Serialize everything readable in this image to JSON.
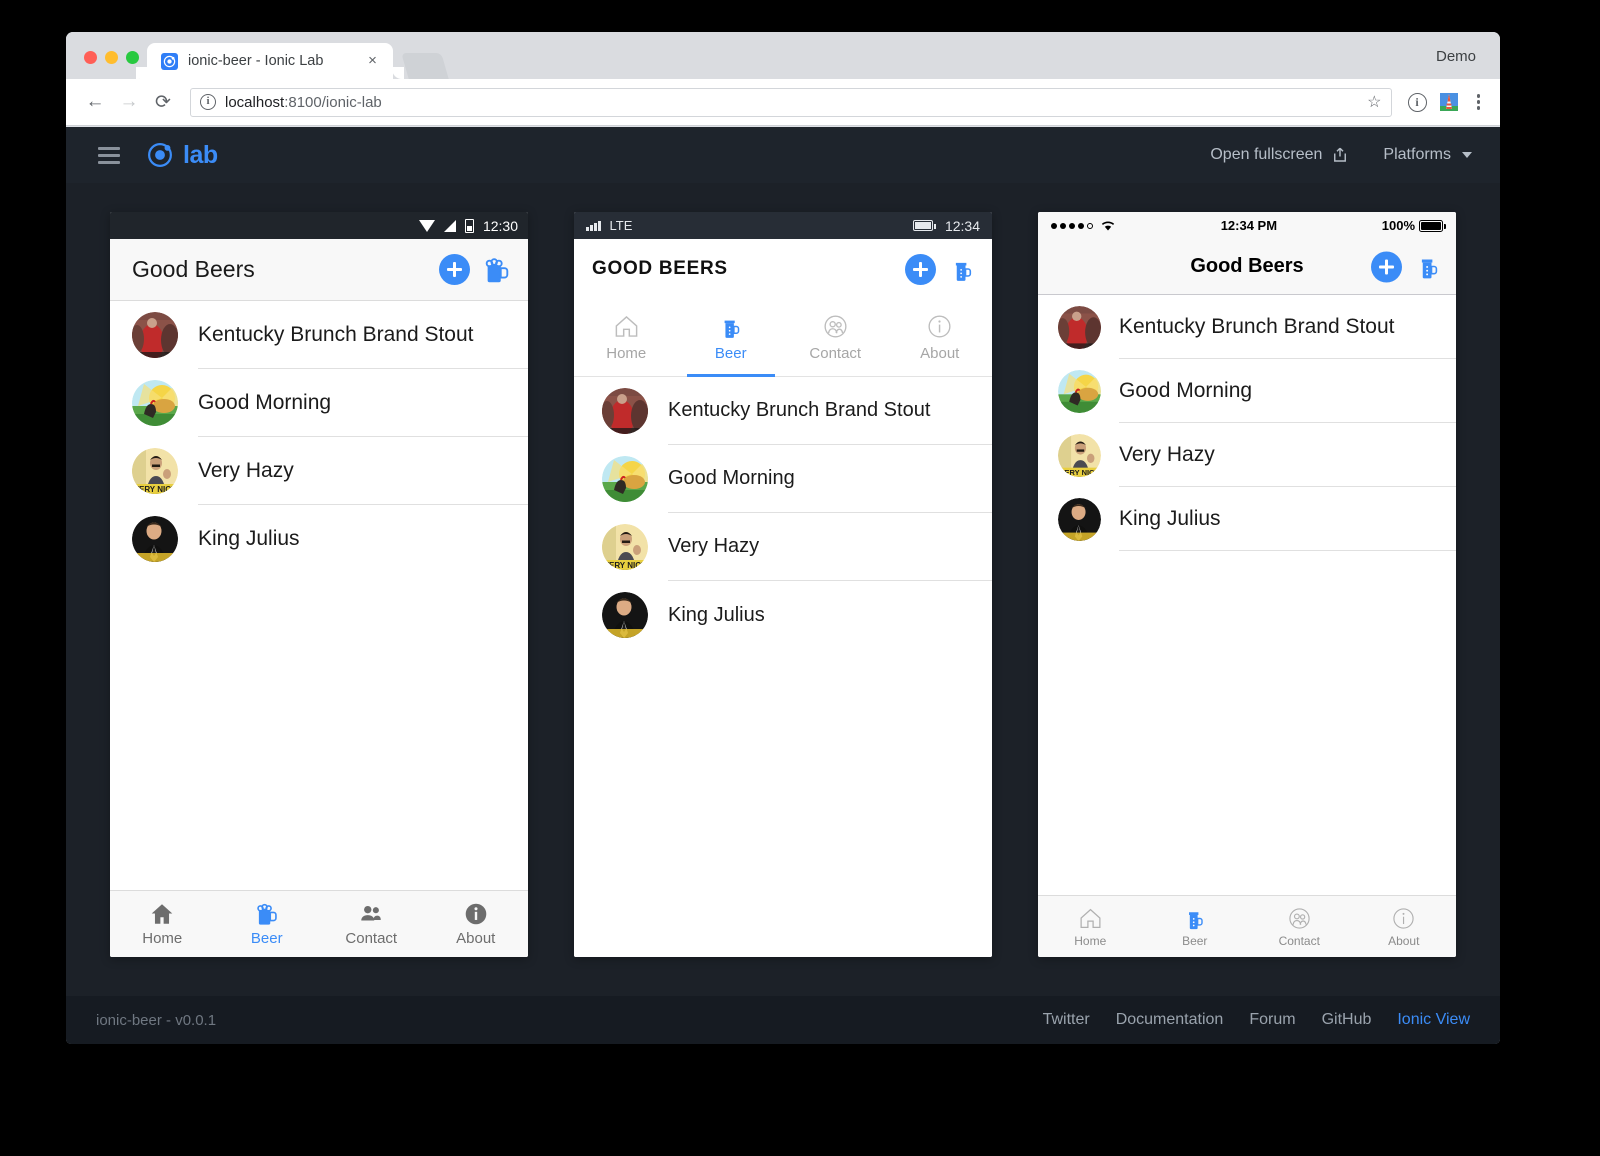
{
  "browser": {
    "tab": {
      "title": "ionic-beer - Ionic Lab",
      "favicon": "ionic-logo-icon",
      "close": "×"
    },
    "profile_label": "Demo",
    "url_prefix": "localhost",
    "url_suffix": ":8100/ionic-lab",
    "url_full": "localhost:8100/ionic-lab",
    "icons": {
      "back": "←",
      "forward": "→",
      "reload": "⟳",
      "site_info": "i",
      "bookmark": "☆",
      "page_info": "info-circle-icon",
      "extension": "lighthouse-icon",
      "menu": "kebab-menu-icon"
    }
  },
  "lab": {
    "brand": "lab",
    "fullscreen_label": "Open fullscreen",
    "platforms_label": "Platforms",
    "footer": {
      "version": "ionic-beer - v0.0.1",
      "links": [
        {
          "label": "Twitter",
          "accent": false
        },
        {
          "label": "Documentation",
          "accent": false
        },
        {
          "label": "Forum",
          "accent": false
        },
        {
          "label": "GitHub",
          "accent": false
        },
        {
          "label": "Ionic View",
          "accent": true
        }
      ]
    }
  },
  "beers": [
    {
      "name": "Kentucky Brunch Brand Stout",
      "avatar": "avatar-red-crowd"
    },
    {
      "name": "Good Morning",
      "avatar": "avatar-rooster-sunrise"
    },
    {
      "name": "Very Hazy",
      "avatar": "avatar-very-nice"
    },
    {
      "name": "King Julius",
      "avatar": "avatar-man-suit"
    }
  ],
  "devices": [
    {
      "platform": "android",
      "statusbar": {
        "time": "12:30",
        "icons": [
          "wifi-icon",
          "signal-icon",
          "battery-icon"
        ]
      },
      "title": "Good Beers",
      "actions": [
        {
          "name": "add-button",
          "icon": "plus-icon"
        },
        {
          "name": "beer-button",
          "icon": "beer-mug-icon"
        }
      ],
      "tabs_position": "bottom",
      "tabs": [
        {
          "label": "Home",
          "icon": "home-icon",
          "active": false
        },
        {
          "label": "Beer",
          "icon": "beer-mug-icon",
          "active": true
        },
        {
          "label": "Contact",
          "icon": "contacts-icon",
          "active": false
        },
        {
          "label": "About",
          "icon": "info-icon",
          "active": false
        }
      ]
    },
    {
      "platform": "windows",
      "statusbar": {
        "network": "LTE",
        "time": "12:34",
        "icons": [
          "signal-bars-icon",
          "battery-icon"
        ]
      },
      "title": "GOOD BEERS",
      "actions": [
        {
          "name": "add-button",
          "icon": "plus-icon"
        },
        {
          "name": "beer-button",
          "icon": "beer-mug-icon"
        }
      ],
      "tabs_position": "top",
      "tabs": [
        {
          "label": "Home",
          "icon": "home-icon",
          "active": false
        },
        {
          "label": "Beer",
          "icon": "beer-mug-icon",
          "active": true
        },
        {
          "label": "Contact",
          "icon": "contacts-icon",
          "active": false
        },
        {
          "label": "About",
          "icon": "info-icon",
          "active": false
        }
      ]
    },
    {
      "platform": "ios",
      "statusbar": {
        "signal": "●●●●○",
        "time": "12:34 PM",
        "battery_text": "100%",
        "icons": [
          "wifi-icon",
          "battery-icon"
        ]
      },
      "title": "Good Beers",
      "actions": [
        {
          "name": "add-button",
          "icon": "plus-icon"
        },
        {
          "name": "beer-button",
          "icon": "beer-mug-icon"
        }
      ],
      "tabs_position": "bottom",
      "tabs": [
        {
          "label": "Home",
          "icon": "home-icon",
          "active": false
        },
        {
          "label": "Beer",
          "icon": "beer-mug-icon",
          "active": true
        },
        {
          "label": "Contact",
          "icon": "contacts-icon",
          "active": false
        },
        {
          "label": "About",
          "icon": "info-icon",
          "active": false
        }
      ]
    }
  ],
  "colors": {
    "accent": "#3b8cf7",
    "lab_bg": "#1c2128",
    "header_bg": "#1e242c",
    "footer_bg": "#161b22"
  }
}
